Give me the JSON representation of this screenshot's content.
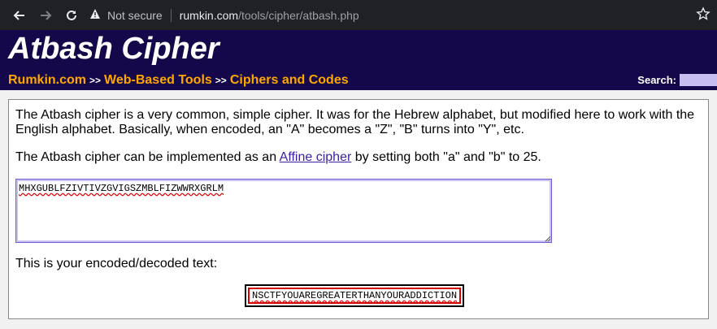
{
  "browser": {
    "security_label": "Not secure",
    "url_host": "rumkin.com",
    "url_path": "/tools/cipher/atbash.php"
  },
  "site": {
    "title": "Atbash Cipher",
    "breadcrumbs": [
      "Rumkin.com",
      "Web-Based Tools",
      "Ciphers and Codes"
    ],
    "breadcrumb_separator": ">>",
    "search_label": "Search:"
  },
  "content": {
    "intro": "The Atbash cipher is a very common, simple cipher. It was for the Hebrew alphabet, but modified here to work with the English alphabet. Basically, when encoded, an \"A\" becomes a \"Z\", \"B\" turns into \"Y\", etc.",
    "affine_prefix": "The Atbash cipher can be implemented as an ",
    "affine_link": "Affine cipher",
    "affine_suffix": " by setting both \"a\" and \"b\" to 25.",
    "input_text": "MHXGUBLFZIVTIVZGVIGSZMBLFIZWWRXGRLM",
    "result_label": "This is your encoded/decoded text:",
    "output_text": "NSCTFYOUAREGREATERTHANYOURADDICTION"
  },
  "colors": {
    "header_bg": "#14074a",
    "crumb": "#ffa600",
    "output_border": "#d40000"
  }
}
